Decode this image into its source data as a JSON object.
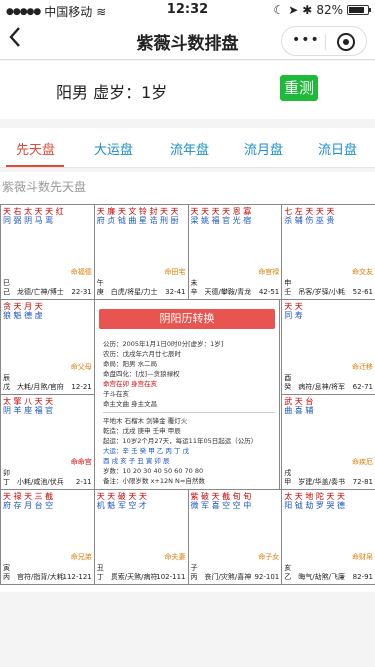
{
  "status": {
    "carrier": "中国移动",
    "time": "12:32",
    "battery": "82%",
    "battery_level": 0.82
  },
  "nav": {
    "title": "紫薇斗数排盘",
    "back_icon": "chevron-left-icon",
    "more": "•••"
  },
  "info": {
    "label": "阳男 虚岁：1岁",
    "retest": "重测"
  },
  "tabs": [
    {
      "label": "先天盘"
    },
    {
      "label": "大运盘"
    },
    {
      "label": "流年盘"
    },
    {
      "label": "流月盘"
    },
    {
      "label": "流日盘"
    }
  ],
  "chart": {
    "heading": "紫薇斗数先天盘",
    "convert": "阴阳历转换",
    "center_lines": [
      "公历：2005年1月1日0时0分[虚岁：1岁]",
      "农历：戊戌年六月廿七辰时",
      "命局：阳男 水二局",
      "命盘四化：[戊]—贪狼禄权",
      "命宫在卯 身宫在亥",
      "子斗在亥",
      "命主文曲 身主文昌",
      "平地木 石榴木 剑锋金 覆灯火",
      "乾造：戊戌 庚申 壬申 甲辰",
      "起运：10岁2个月27天，每运11年05日起运（公历）",
      "大运：辛 壬 癸 甲 乙 丙 丁 戊",
      "酉 戌 亥 子 丑 寅 卯 辰",
      "岁数：10 20 30 40 50 60 70 80",
      "备注：小限岁数 x+12N N=自然数"
    ],
    "cells": [
      {
        "stars": "天 右 太 天 天 红",
        "row2": "同 弼 阴 马 鸾",
        "palace": "命福德",
        "branch": "巳 己",
        "bottom": "龙德/亡神/博士",
        "ages": "22-31"
      },
      {
        "stars": "天 廉 天 文 铃 封 天 天",
        "row2": "府 贞 钺 曲 星 诰 刑 厨",
        "palace": "命田宅",
        "branch": "午 庚",
        "bottom": "白虎/将星/力士",
        "ages": "32-41"
      },
      {
        "stars": "天 天 天 天 恩 寡",
        "row2": "梁 姚 福 官 光 宿",
        "palace": "命官禄",
        "branch": "未 辛",
        "bottom": "天德/攀鞍/青龙",
        "ages": "42-51"
      },
      {
        "stars": "七 左 天 天 天",
        "row2": "杀 辅 伤 巫 贵",
        "palace": "命交友",
        "branch": "申 壬",
        "bottom": "吊客/岁驿/小耗",
        "ages": "52-61"
      },
      {
        "stars": "贪 天 月 天",
        "row2": "狼 魁 德 虚",
        "palace": "命父母",
        "branch": "辰 戊",
        "bottom": "大耗/月煞/官府",
        "ages": "12-21"
      },
      {
        "stars": "天 天",
        "row2": "同 寿",
        "palace": "命迁移",
        "branch": "酉 癸",
        "bottom": "病符/息神/将军",
        "ages": "62-71"
      },
      {
        "stars": "太 擎 八 天 天",
        "row2": "阴 羊 座 福 官",
        "palace": "命命宫",
        "branch": "卯 丁",
        "bottom": "小耗/咸池/伏兵",
        "ages": "2-11"
      },
      {
        "stars": "武 天 台",
        "row2": "曲 喜 辅",
        "palace": "命疾厄",
        "branch": "戌 甲",
        "bottom": "岁建/华盖/奏书",
        "ages": "72-81"
      },
      {
        "stars": "天 禄 天 三 截",
        "row2": "府 存 月 台 空",
        "palace": "命兄弟",
        "branch": "寅 丙",
        "bottom": "官符/指背/大耗",
        "ages": "112-121"
      },
      {
        "stars": "天 天 破 天 天",
        "row2": "机 魁 军 空 才",
        "palace": "命夫妻",
        "branch": "丑 丁",
        "bottom": "贯索/天煞/病符",
        "ages": "102-111"
      },
      {
        "stars": "紫 破 天 截 旬 旬",
        "row2": "微 军 喜 空 空 中",
        "palace": "命子女",
        "branch": "子 丙",
        "bottom": "丧门/灾煞/喜神",
        "ages": "92-101"
      },
      {
        "stars": "太 天 地 陀 天 天",
        "row2": "阳 钺 劫 罗 哭 德",
        "palace": "命财帛",
        "branch": "亥 乙",
        "bottom": "晦气/劫煞/飞廉",
        "ages": "82-91"
      }
    ]
  }
}
